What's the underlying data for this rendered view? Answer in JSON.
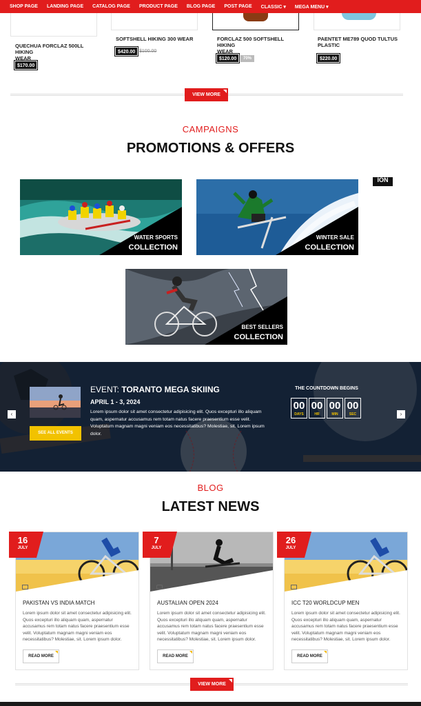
{
  "nav": {
    "items": [
      "SHOP PAGE",
      "LANDING PAGE",
      "CATALOG PAGE",
      "PRODUCT PAGE",
      "BLOG PAGE",
      "POST PAGE",
      "CLASSIC ▾",
      "MEGA MENU ▾"
    ]
  },
  "products": [
    {
      "title_line1": "QUECHUA FORCLAZ 500LL HIKING",
      "title_line2": "WEAR",
      "price": "$170.00"
    },
    {
      "title_line1": "SOFTSHELL HIKING 300 WEAR",
      "title_line2": "",
      "price": "$420.00",
      "old_price": "$100.00"
    },
    {
      "title_line1": "FORCLAZ 500 SOFTSHELL HIKING",
      "title_line2": "WEAR",
      "price": "$120.00",
      "tag": "70%"
    },
    {
      "title_line1": "PAENTET ME789 QUOD TULTUS",
      "title_line2": "PLASTIC",
      "price": "$220.00"
    }
  ],
  "view_more_1": "VIEW MORE",
  "campaigns": {
    "subheading": "CAMPAIGNS",
    "heading": "PROMOTIONS & OFFERS",
    "partial_label": "ION",
    "promos": [
      {
        "label1": "WATER SPORTS",
        "label2": "COLLECTION"
      },
      {
        "label1": "WINTER SALE",
        "label2": "COLLECTION"
      },
      {
        "label1": "BEST SELLERS",
        "label2": "COLLECTION"
      }
    ]
  },
  "event": {
    "prefix": "EVENT:",
    "name": "TORANTO MEGA SKIING",
    "date": "APRIL 1 - 3, 2024",
    "description": "Lorem ipsum dolor sit amet consectetur adipisicing elit. Quos excepturi illo aliquam quam, aspernatur accusamus rem totam natus facere praesentium esse velit. Voluptatum magnam magni veniam eos necessitatibus? Molestiae, sit. Lorem ipsum dolor.",
    "see_all": "SEE ALL EVENTS",
    "countdown_title": "THE COUNTDOWN BEGINS",
    "countdown": [
      {
        "n": "00",
        "u": "DAYS"
      },
      {
        "n": "00",
        "u": "HR"
      },
      {
        "n": "00",
        "u": "MIN"
      },
      {
        "n": "00",
        "u": "SEC"
      }
    ],
    "prev": "‹",
    "next": "›"
  },
  "blog": {
    "subheading": "BLOG",
    "heading": "LATEST NEWS",
    "read_more": "READ MORE",
    "view_more": "VIEW MORE",
    "posts": [
      {
        "day": "16",
        "month": "JULY",
        "title": "PAKISTAN VS INDIA MATCH",
        "icon": "image-icon",
        "text": "Lorem ipsum dolor sit amet consectetur adipisicing elit. Quos excepturi illo aliquam quam, aspernatur accusamus rem totam natus facere praesentium esse velit. Voluptatum magnam magni veniam eos necessitatibus? Molestiae, sit. Lorem ipsum dolor."
      },
      {
        "day": "7",
        "month": "JULY",
        "title": "AUSTALIAN OPEN 2024",
        "icon": "camera-icon",
        "text": "Lorem ipsum dolor sit amet consectetur adipisicing elit. Quos excepturi illo aliquam quam, aspernatur accusamus rem totam natus facere praesentium esse velit. Voluptatum magnam magni veniam eos necessitatibus? Molestiae, sit. Lorem ipsum dolor."
      },
      {
        "day": "26",
        "month": "JULY",
        "title": "ICC T20 WORLDCUP MEN",
        "icon": "image-icon",
        "text": "Lorem ipsum dolor sit amet consectetur adipisicing elit. Quos excepturi illo aliquam quam, aspernatur accusamus rem totam natus facere praesentium esse velit. Voluptatum magnam magni veniam eos necessitatibus? Molestiae, sit. Lorem ipsum dolor."
      }
    ]
  },
  "colors": {
    "accent": "#e11d1d",
    "event_bg": "#1a2a40",
    "highlight": "#f2c200"
  }
}
